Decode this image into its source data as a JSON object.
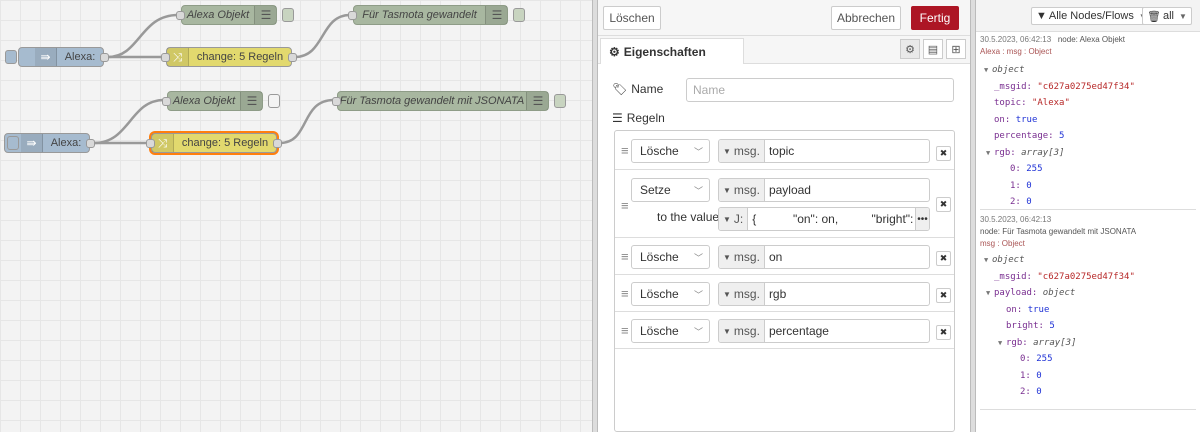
{
  "canvas": {
    "nodes": [
      {
        "id": "alexa-in-1",
        "label": "Alexa:",
        "type": "alexa-input"
      },
      {
        "id": "alexa-obj-1",
        "label": "Alexa Objekt",
        "type": "debug"
      },
      {
        "id": "change-1",
        "label": "change: 5 Regeln",
        "type": "change"
      },
      {
        "id": "tasmota-1",
        "label": "Für Tasmota gewandelt",
        "type": "debug"
      },
      {
        "id": "alexa-in-2",
        "label": "Alexa:",
        "type": "alexa-input"
      },
      {
        "id": "alexa-obj-2",
        "label": "Alexa Objekt",
        "type": "debug"
      },
      {
        "id": "change-2",
        "label": "change: 5 Regeln",
        "type": "change",
        "selected": true
      },
      {
        "id": "tasmota-2",
        "label": "Für Tasmota gewandelt mit JSONATA",
        "type": "debug"
      }
    ]
  },
  "editor": {
    "delete_label": "Löschen",
    "cancel_label": "Abbrechen",
    "done_label": "Fertig",
    "tab_label": "Eigenschaften",
    "name_label": "Name",
    "name_placeholder": "Name",
    "rules_label": "Regeln",
    "to_value_label": "to the value",
    "rules": [
      {
        "action": "Lösche",
        "type": "msg.",
        "property": "topic"
      },
      {
        "action": "Setze",
        "type": "msg.",
        "property": "payload",
        "value_type_icon": "J:",
        "value": "{           \"on\": on,          \"bright\": percentage"
      },
      {
        "action": "Lösche",
        "type": "msg.",
        "property": "on"
      },
      {
        "action": "Lösche",
        "type": "msg.",
        "property": "rgb"
      },
      {
        "action": "Lösche",
        "type": "msg.",
        "property": "percentage"
      }
    ]
  },
  "debug": {
    "filter_label": "Alle Nodes/Flows",
    "clear_label": "all",
    "messages": [
      {
        "timestamp": "30.5.2023, 06:42:13",
        "node": "node: Alexa Objekt",
        "topic": "Alexa : msg : Object",
        "root": "object",
        "msgid_key": "_msgid:",
        "msgid_val": "\"c627a0275ed47f34\"",
        "topic_key": "topic:",
        "topic_val": "\"Alexa\"",
        "on_key": "on:",
        "on_val": "true",
        "pct_key": "percentage:",
        "pct_val": "5",
        "rgb_key": "rgb:",
        "rgb_type": "array[3]",
        "rgb": [
          {
            "i": "0:",
            "v": "255"
          },
          {
            "i": "1:",
            "v": "0"
          },
          {
            "i": "2:",
            "v": "0"
          }
        ]
      },
      {
        "timestamp": "30.5.2023, 06:42:13",
        "node": "node: Für Tasmota gewandelt mit JSONATA",
        "topic": "msg : Object",
        "root": "object",
        "msgid_key": "_msgid:",
        "msgid_val": "\"c627a0275ed47f34\"",
        "payload_key": "payload:",
        "payload_type": "object",
        "on_key": "on:",
        "on_val": "true",
        "bright_key": "bright:",
        "bright_val": "5",
        "rgb_key": "rgb:",
        "rgb_type": "array[3]",
        "rgb": [
          {
            "i": "0:",
            "v": "255"
          },
          {
            "i": "1:",
            "v": "0"
          },
          {
            "i": "2:",
            "v": "0"
          }
        ]
      }
    ]
  }
}
